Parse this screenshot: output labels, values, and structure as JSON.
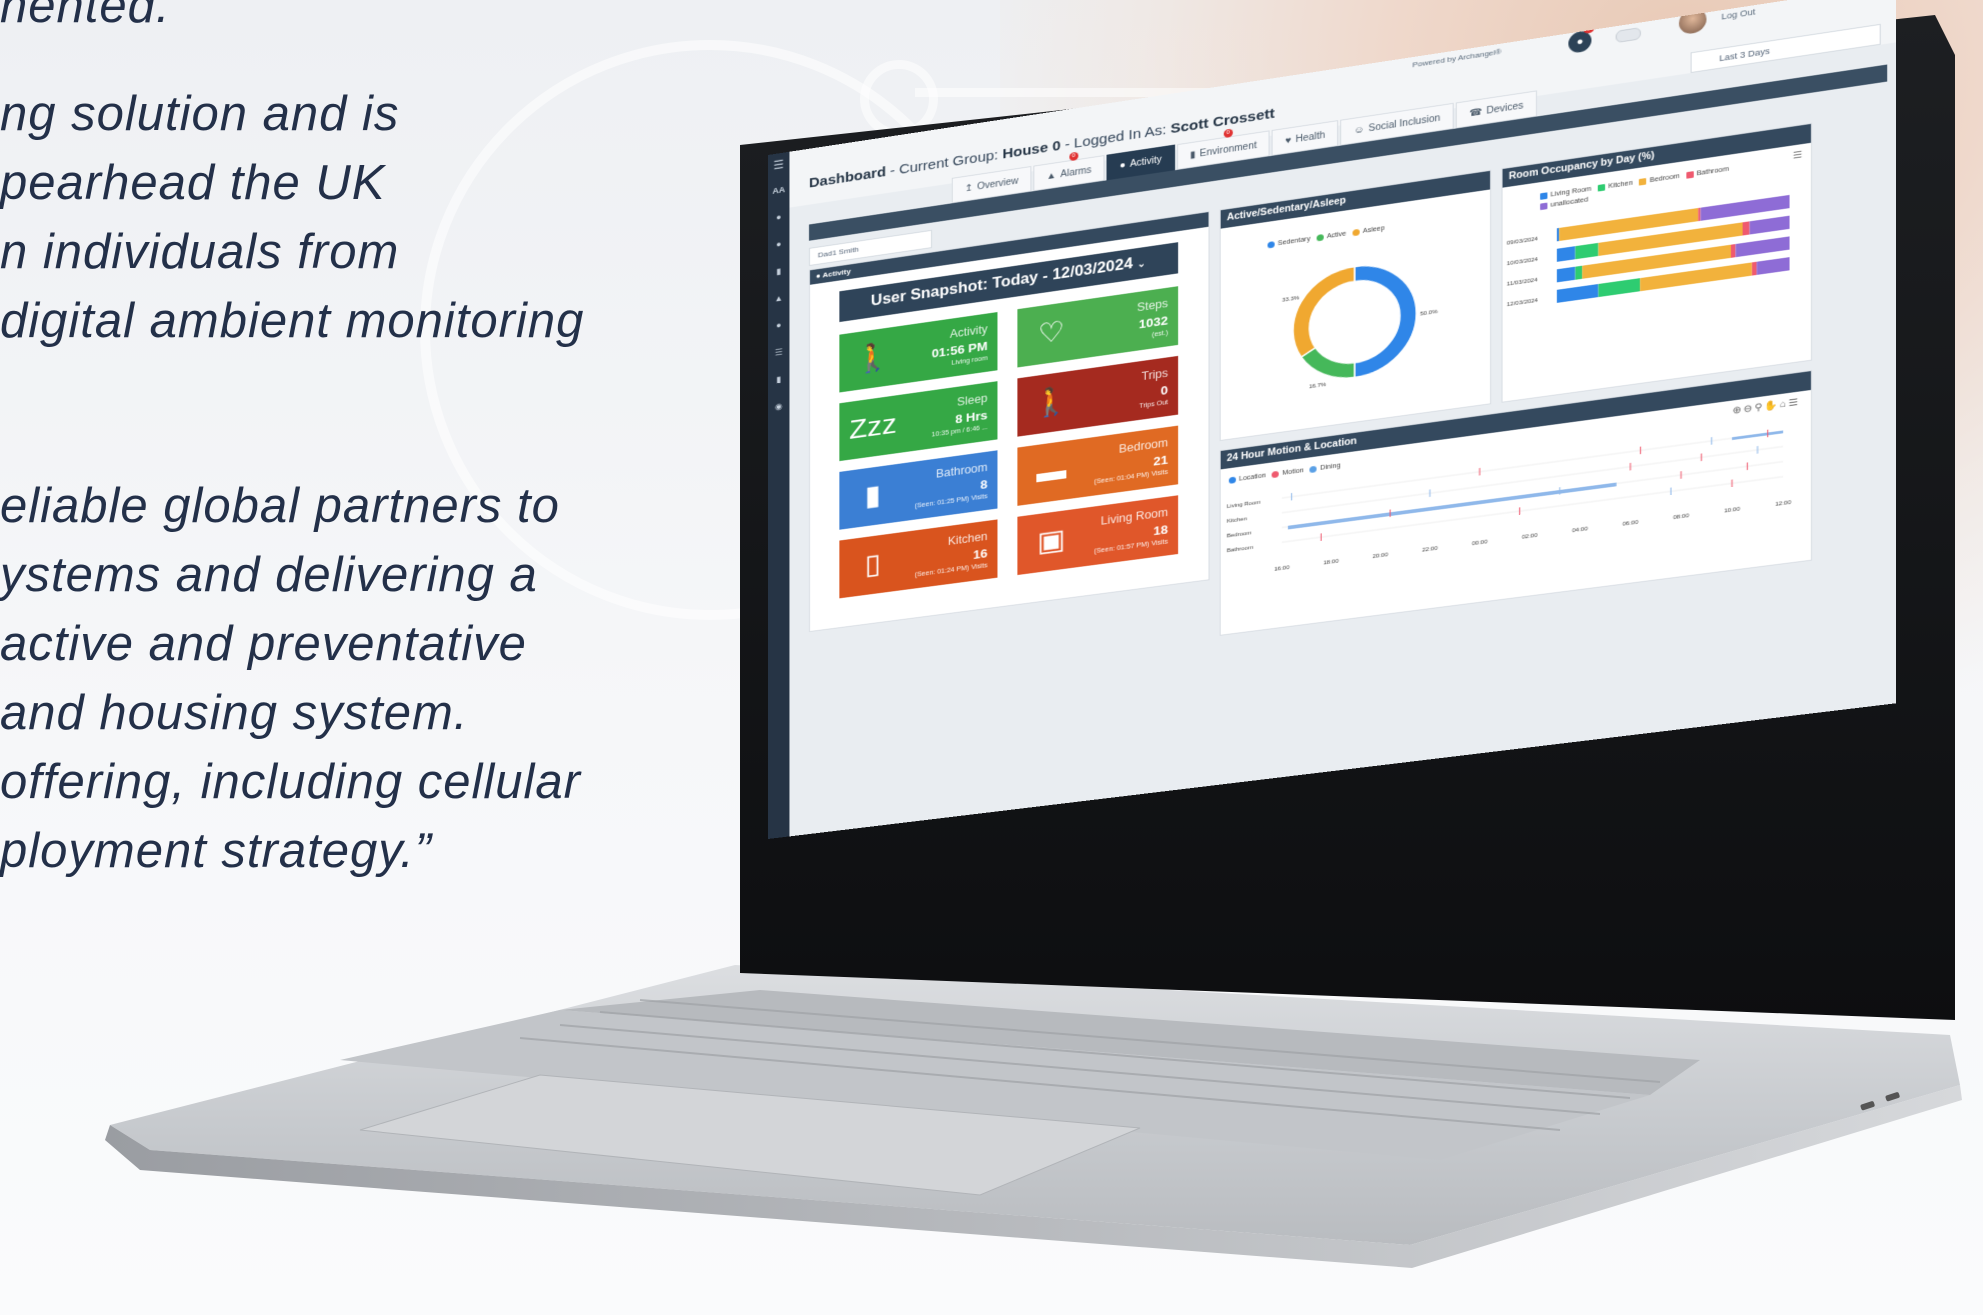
{
  "quote": {
    "lines": [
      "nented.",
      "ng solution and is",
      "pearhead the UK",
      "n individuals from",
      "digital ambient monitoring",
      "eliable global partners to",
      "ystems and delivering a",
      "active and preventative",
      " and housing system.",
      " offering, including cellular",
      "ployment strategy.”"
    ]
  },
  "dashboard": {
    "sidebar": {
      "brand": "AA"
    },
    "header": {
      "powered_by": "Powered by Archangel®",
      "bell_count": "0",
      "logout": "Log Out"
    },
    "breadcrumb": {
      "title": "Dashboard",
      "group_label": " - Current Group: ",
      "group": "House 0",
      "logged_label": " - Logged In As: ",
      "user": "Scott Crossett"
    },
    "resident_select": "Dad1 Smith",
    "date_range": "Last 3 Days",
    "tabs": [
      {
        "label": "Overview",
        "badge": ""
      },
      {
        "label": "Alarms",
        "badge": "0"
      },
      {
        "label": "Activity",
        "badge": ""
      },
      {
        "label": "Environment",
        "badge": "0"
      },
      {
        "label": "Health",
        "badge": ""
      },
      {
        "label": "Social Inclusion",
        "badge": ""
      },
      {
        "label": "Devices",
        "badge": ""
      }
    ],
    "activity_header": "Activity",
    "snapshot_title": "User Snapshot: Today - 12/03/2024",
    "tiles": [
      {
        "label": "Activity",
        "value": "01:56 PM",
        "sub": "Living room",
        "color": "#35a845",
        "icon": "walking-person-icon"
      },
      {
        "label": "Steps",
        "value": "1032",
        "sub": "(est.)",
        "color": "#4caf50",
        "icon": "heart-icon"
      },
      {
        "label": "Sleep",
        "value": "8 Hrs",
        "sub": "10:35 pm / 6:46 ...",
        "color": "#35a845",
        "icon": "sleep-zzz-icon"
      },
      {
        "label": "Trips",
        "value": "0",
        "sub": "Trips Out",
        "color": "#a52a1f",
        "icon": "walking-person-icon"
      },
      {
        "label": "Bathroom",
        "value": "8",
        "sub": "(Seen: 01:25 PM) Visits",
        "color": "#3b7fd4",
        "icon": "toilet-icon"
      },
      {
        "label": "Bedroom",
        "value": "21",
        "sub": "(Seen: 01:04 PM) Visits",
        "color": "#e06a23",
        "icon": "bed-icon"
      },
      {
        "label": "Kitchen",
        "value": "16",
        "sub": "(Seen: 01:24 PM) Visits",
        "color": "#d9541e",
        "icon": "fridge-icon"
      },
      {
        "label": "Living Room",
        "value": "18",
        "sub": "(Seen: 01:57 PM) Visits",
        "color": "#e0572a",
        "icon": "fireplace-icon"
      }
    ],
    "donut_title": "Active/Sedentary/Asleep",
    "occupancy_title": "Room Occupancy by Day (%)",
    "motion_title": "24 Hour Motion & Location",
    "motion_legend": [
      "Location",
      "Motion",
      "Dining"
    ]
  },
  "chart_data": [
    {
      "type": "pie",
      "title": "Active/Sedentary/Asleep",
      "categories": [
        "Sedentary",
        "Active",
        "Asleep"
      ],
      "values": [
        50.0,
        16.7,
        33.3
      ],
      "colors": [
        "#2f86e8",
        "#45b85a",
        "#f0a830"
      ],
      "legend": "top"
    },
    {
      "type": "bar",
      "stacked": true,
      "orientation": "horizontal",
      "title": "Room Occupancy by Day (%)",
      "categories": [
        "09/03/2024",
        "10/03/2024",
        "11/03/2024",
        "12/03/2024"
      ],
      "series": [
        {
          "name": "Living Room",
          "color": "#2f86e8",
          "values": [
            1,
            8,
            8,
            18
          ]
        },
        {
          "name": "Kitchen",
          "color": "#2ecc71",
          "values": [
            0,
            10,
            3,
            18
          ]
        },
        {
          "name": "Bedroom",
          "color": "#f2b23c",
          "values": [
            60,
            62,
            64,
            48
          ]
        },
        {
          "name": "Bathroom",
          "color": "#ef5a6f",
          "values": [
            1,
            3,
            2,
            2
          ]
        },
        {
          "name": "unallocated",
          "color": "#8e6cd6",
          "values": [
            38,
            17,
            23,
            14
          ]
        }
      ],
      "legend": "top"
    },
    {
      "type": "scatter",
      "title": "24 Hour Motion & Location",
      "categories": [
        "Living Room",
        "Kitchen",
        "Bedroom",
        "Bathroom"
      ],
      "x_ticks": [
        "16:00",
        "18:00",
        "20:00",
        "22:00",
        "00:00",
        "02:00",
        "04:00",
        "06:00",
        "08:00",
        "10:00",
        "12:00"
      ],
      "series": [
        {
          "name": "Location",
          "color": "#2f86e8"
        },
        {
          "name": "Motion",
          "color": "#ef5a6f"
        },
        {
          "name": "Dining",
          "color": "#5aa0e6"
        }
      ],
      "legend": "top-left"
    }
  ]
}
